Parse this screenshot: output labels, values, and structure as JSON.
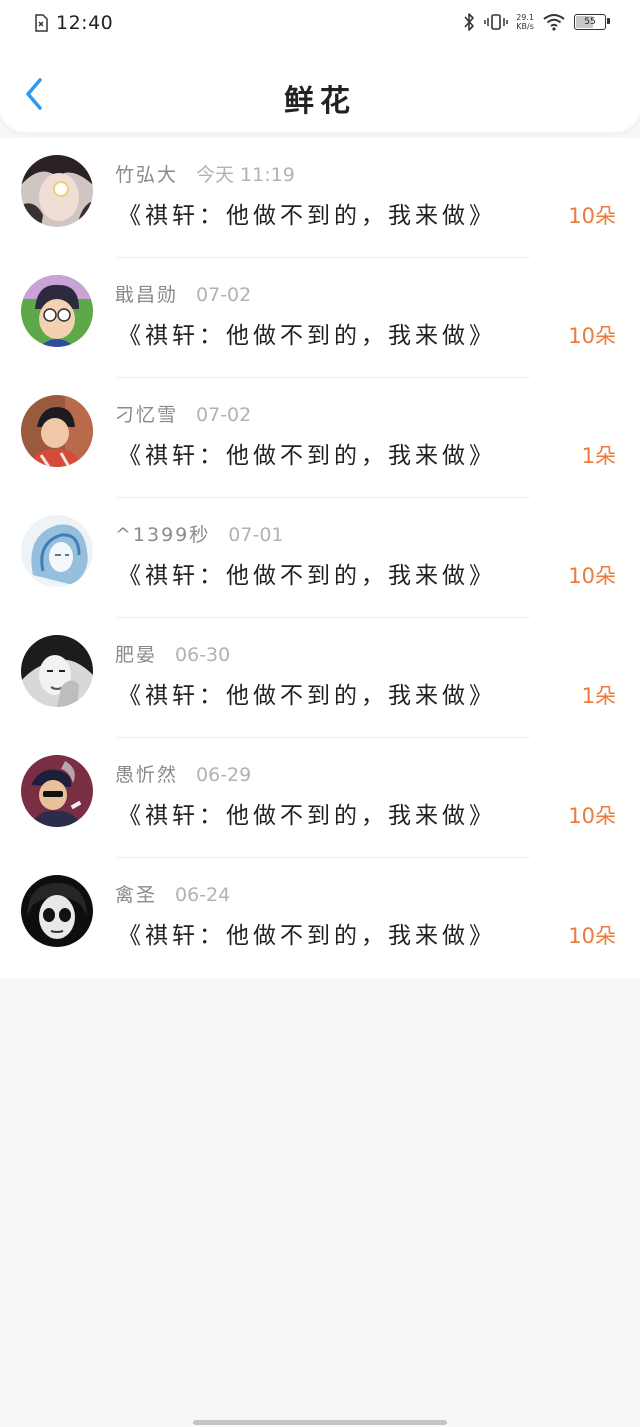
{
  "status_bar": {
    "time": "12:40",
    "speed_value": "29.1",
    "speed_unit": "KB/s",
    "battery": "55"
  },
  "header": {
    "title": "鲜花"
  },
  "items": [
    {
      "name": "竹弘大",
      "date": "今天 11:19",
      "title": "《祺轩：他做不到的，我来做》",
      "count": "10朵"
    },
    {
      "name": "戢昌勋",
      "date": "07-02",
      "title": "《祺轩：他做不到的，我来做》",
      "count": "10朵"
    },
    {
      "name": "刁忆雪",
      "date": "07-02",
      "title": "《祺轩：他做不到的，我来做》",
      "count": "1朵"
    },
    {
      "name": "^1399秒",
      "date": "07-01",
      "title": "《祺轩：他做不到的，我来做》",
      "count": "10朵"
    },
    {
      "name": "肥晏",
      "date": "06-30",
      "title": "《祺轩：他做不到的，我来做》",
      "count": "1朵"
    },
    {
      "name": "愚忻然",
      "date": "06-29",
      "title": "《祺轩：他做不到的，我来做》",
      "count": "10朵"
    },
    {
      "name": "禽圣",
      "date": "06-24",
      "title": "《祺轩：他做不到的，我来做》",
      "count": "10朵"
    }
  ],
  "colors": {
    "accent_back": "#2b9af3",
    "count": "#ee7a3a"
  }
}
